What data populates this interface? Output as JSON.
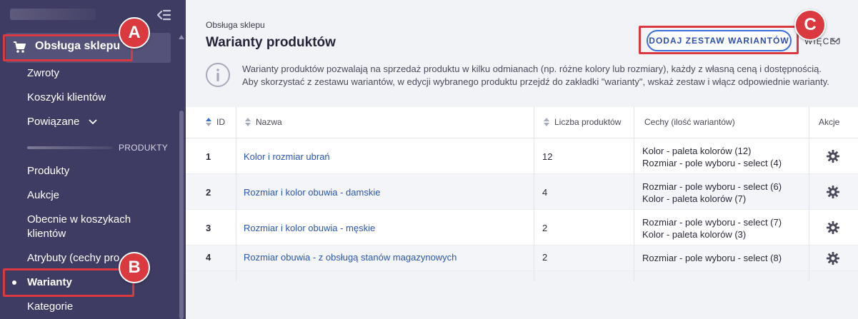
{
  "sidebar": {
    "section_label": "Obsługa sklepu",
    "items": [
      {
        "label": "Zwroty"
      },
      {
        "label": "Koszyki klientów"
      },
      {
        "label": "Powiązane"
      }
    ],
    "group_label": "PRODUKTY",
    "group_items": [
      {
        "label": "Produkty"
      },
      {
        "label": "Aukcje"
      },
      {
        "label": "Obecnie w koszykach klientów"
      },
      {
        "label": "Atrybuty (cechy pro"
      },
      {
        "label": "Warianty"
      },
      {
        "label": "Kategorie"
      }
    ],
    "active_item": "Warianty"
  },
  "annotations": {
    "a": "A",
    "b": "B",
    "c": "C",
    "color": "#d9393f"
  },
  "header": {
    "breadcrumb": "Obsługa sklepu",
    "title": "Warianty produktów",
    "add_button": "DODAJ ZESTAW WARIANTÓW",
    "more_link": "WIĘCEJ"
  },
  "info": {
    "line1": "Warianty produktów pozwalają na sprzedaż produktu w kilku odmianach (np. różne kolory lub rozmiary), każdy z własną ceną i dostępnością.",
    "line2": "Aby skorzystać z zestawu wariantów, w edycji wybranego produktu przejdź do zakładki \"warianty\", wskaż zestaw i włącz odpowiednie warianty."
  },
  "table": {
    "columns": {
      "id": "ID",
      "name": "Nazwa",
      "count": "Liczba produktów",
      "features": "Cechy (ilość wariantów)",
      "actions": "Akcje"
    },
    "rows": [
      {
        "id": "1",
        "name": "Kolor i rozmiar ubrań",
        "count": "12",
        "features": [
          "Kolor - paleta kolorów (12)",
          "Rozmiar - pole wyboru - select (4)"
        ]
      },
      {
        "id": "2",
        "name": "Rozmiar i kolor obuwia - damskie",
        "count": "4",
        "features": [
          "Rozmiar - pole wyboru - select (6)",
          "Kolor - paleta kolorów (7)"
        ]
      },
      {
        "id": "3",
        "name": "Rozmiar i kolor obuwia - męskie",
        "count": "2",
        "features": [
          "Rozmiar - pole wyboru - select (7)",
          "Kolor - paleta kolorów (3)"
        ]
      },
      {
        "id": "4",
        "name": "Rozmiar obuwia - z obsługą stanów magazynowych",
        "count": "2",
        "features": [
          "Rozmiar - pole wyboru - select (8)"
        ]
      }
    ]
  },
  "icons": {
    "collapse": "collapse-sidebar-icon",
    "cart": "cart-icon",
    "info": "info-icon",
    "sort": "sort-icon",
    "gear": "gear-icon",
    "chevron": "chevron-down-icon"
  },
  "colors": {
    "sidebar_bg": "#3f3c63",
    "link": "#2b56b5",
    "button_border": "#3a6dd8",
    "highlight": "#d9393f"
  }
}
